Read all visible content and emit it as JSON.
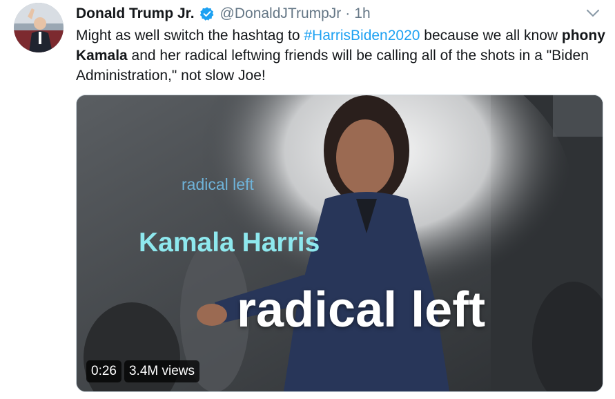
{
  "tweet": {
    "display_name": "Donald Trump Jr.",
    "handle": "@DonaldJTrumpJr",
    "separator": "·",
    "time": "1h",
    "text_part1": "Might as well switch the hashtag to ",
    "hashtag": "#HarrisBiden2020",
    "text_part2": " because we all know ",
    "bold_phrase": "phony Kamala",
    "text_part3": " and her radical leftwing friends will be calling all of the shots in a \"Biden Administration,\" not slow Joe!"
  },
  "media": {
    "overlay_small": "radical left",
    "overlay_name": "Kamala Harris",
    "overlay_big": "radical left",
    "duration": "0:26",
    "views": "3.4M views"
  },
  "colors": {
    "hashtag": "#1da1f2",
    "verified": "#1da1f2",
    "meta_gray": "#657786"
  },
  "icons": {
    "verified": "verified-badge-icon",
    "caret": "chevron-down-icon",
    "avatar": "avatar"
  }
}
